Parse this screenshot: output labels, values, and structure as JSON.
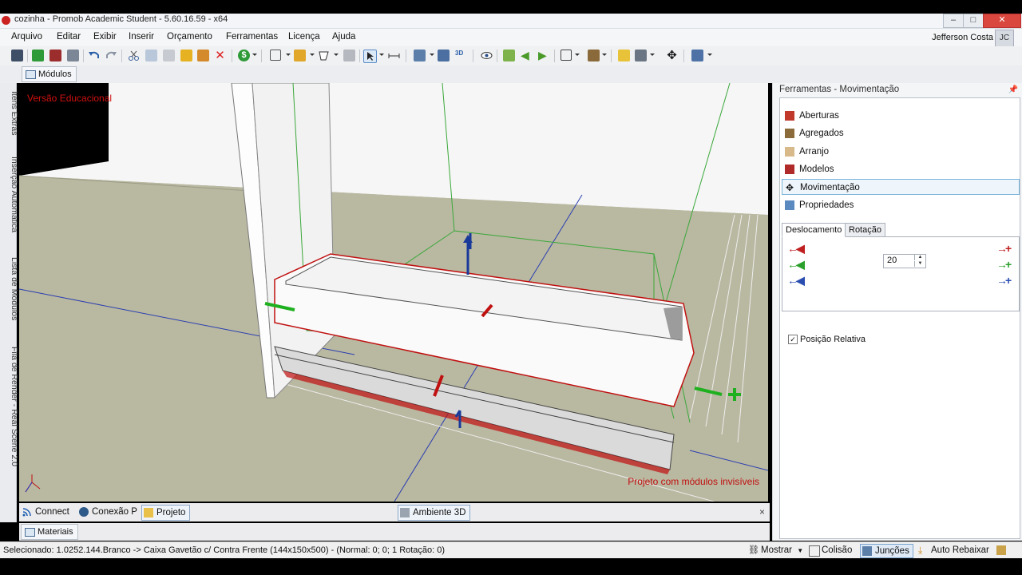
{
  "window": {
    "title": "cozinha - Promob Academic Student - 5.60.16.59 - x64"
  },
  "menu": [
    "Arquivo",
    "Editar",
    "Exibir",
    "Inserir",
    "Orçamento",
    "Ferramentas",
    "Licença",
    "Ajuda"
  ],
  "user": {
    "name": "Jefferson Costa",
    "initials": "JC"
  },
  "doc_tab": "Módulos",
  "left_rail": [
    "Itens Extras",
    "Inserção Automática",
    "Lista de Módulos",
    "Fila de Render - Real Scene 2.0"
  ],
  "viewport": {
    "watermark": "Versão Educacional",
    "notice": "Projeto com módulos invisíveis"
  },
  "bottom_tabs": {
    "connect": "Connect",
    "conexao": "Conexão P",
    "projeto": "Projeto",
    "ambiente": "Ambiente 3D",
    "close": "×"
  },
  "materials_tab": "Materiais",
  "status": {
    "text": "Selecionado: 1.0252.144.Branco -> Caixa Gavetão c/ Contra Frente (144x150x500) - (Normal: 0; 0; 1 Rotação: 0)",
    "mostrar": "Mostrar",
    "colisao": "Colisão",
    "juncoes": "Junções",
    "auto_rebaixar": "Auto Rebaixar"
  },
  "tools_panel": {
    "title": "Ferramentas - Movimentação",
    "items": [
      "Aberturas",
      "Agregados",
      "Arranjo",
      "Modelos",
      "Movimentação",
      "Propriedades"
    ],
    "active_item": "Movimentação",
    "tabs": [
      "Deslocamento",
      "Rotação"
    ],
    "step_value": "20",
    "relative_checkbox": "Posição Relativa"
  },
  "colors": {
    "red": "#d01010",
    "green": "#20b020",
    "blue": "#2050c0",
    "floor": "#b9b8a1"
  }
}
